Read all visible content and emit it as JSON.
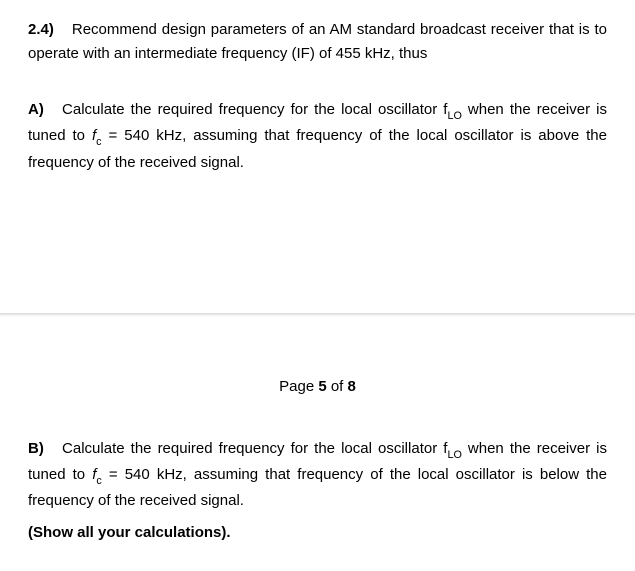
{
  "question": {
    "number": "2.4)",
    "intro_a": "Recommend design parameters of an AM standard broadcast receiver that is to operate with an intermediate frequency (IF) of 455 kHz, thus"
  },
  "partA": {
    "label": "A)",
    "t1": "Calculate the required frequency for the local oscillator f",
    "sub1": "LO",
    "t2": " when the receiver is tuned to ",
    "fc": "f",
    "fc_sub": "c",
    "t3": " = 540 kHz, assuming that frequency of the local oscillator is above the frequency of the received signal."
  },
  "pager": {
    "prefix": "Page ",
    "current": "5",
    "of": " of ",
    "total": "8"
  },
  "partB": {
    "label": "B)",
    "t1": "Calculate the required frequency for the local oscillator f",
    "sub1": "LO",
    "t2": " when the receiver is tuned to ",
    "fc": "f",
    "fc_sub": "c",
    "t3": " = 540 kHz, assuming that frequency of the local oscillator is below the frequency of the received signal.",
    "note": "(Show all your calculations)."
  }
}
